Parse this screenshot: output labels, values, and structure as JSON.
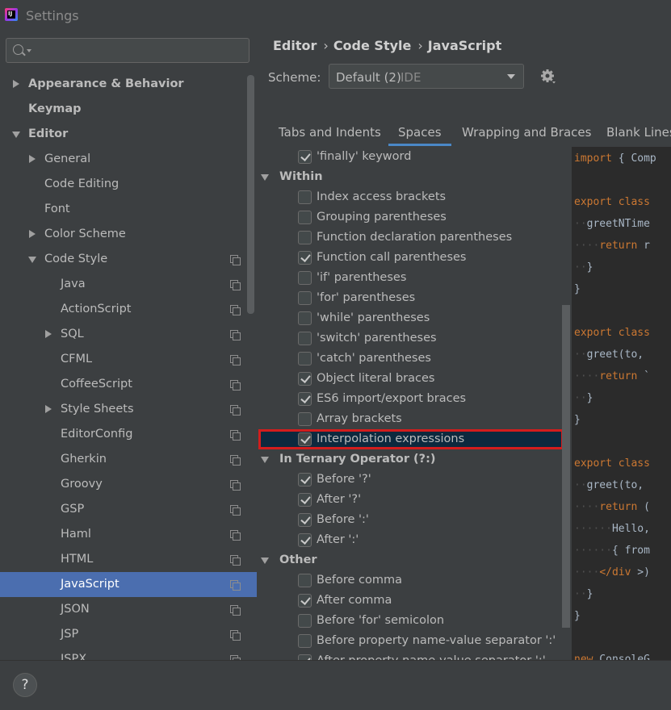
{
  "window": {
    "title": "Settings",
    "app_icon_text": "IJ"
  },
  "search": {
    "placeholder": ""
  },
  "sidebar": {
    "items": [
      {
        "label": "Appearance & Behavior",
        "level": 0,
        "bold": true,
        "expander": "collapsed",
        "copy_icon": false,
        "selected": false
      },
      {
        "label": "Keymap",
        "level": 0,
        "bold": true,
        "expander": "none",
        "copy_icon": false,
        "selected": false
      },
      {
        "label": "Editor",
        "level": 0,
        "bold": true,
        "expander": "expanded",
        "copy_icon": false,
        "selected": false
      },
      {
        "label": "General",
        "level": 1,
        "bold": false,
        "expander": "collapsed",
        "copy_icon": false,
        "selected": false
      },
      {
        "label": "Code Editing",
        "level": 1,
        "bold": false,
        "expander": "none",
        "copy_icon": false,
        "selected": false
      },
      {
        "label": "Font",
        "level": 1,
        "bold": false,
        "expander": "none",
        "copy_icon": false,
        "selected": false
      },
      {
        "label": "Color Scheme",
        "level": 1,
        "bold": false,
        "expander": "collapsed",
        "copy_icon": false,
        "selected": false
      },
      {
        "label": "Code Style",
        "level": 1,
        "bold": false,
        "expander": "expanded",
        "copy_icon": true,
        "selected": false
      },
      {
        "label": "Java",
        "level": 2,
        "bold": false,
        "expander": "none",
        "copy_icon": true,
        "selected": false
      },
      {
        "label": "ActionScript",
        "level": 2,
        "bold": false,
        "expander": "none",
        "copy_icon": true,
        "selected": false
      },
      {
        "label": "SQL",
        "level": 2,
        "bold": false,
        "expander": "collapsed",
        "copy_icon": true,
        "selected": false
      },
      {
        "label": "CFML",
        "level": 2,
        "bold": false,
        "expander": "none",
        "copy_icon": true,
        "selected": false
      },
      {
        "label": "CoffeeScript",
        "level": 2,
        "bold": false,
        "expander": "none",
        "copy_icon": true,
        "selected": false
      },
      {
        "label": "Style Sheets",
        "level": 2,
        "bold": false,
        "expander": "collapsed",
        "copy_icon": true,
        "selected": false
      },
      {
        "label": "EditorConfig",
        "level": 2,
        "bold": false,
        "expander": "none",
        "copy_icon": true,
        "selected": false
      },
      {
        "label": "Gherkin",
        "level": 2,
        "bold": false,
        "expander": "none",
        "copy_icon": true,
        "selected": false
      },
      {
        "label": "Groovy",
        "level": 2,
        "bold": false,
        "expander": "none",
        "copy_icon": true,
        "selected": false
      },
      {
        "label": "GSP",
        "level": 2,
        "bold": false,
        "expander": "none",
        "copy_icon": true,
        "selected": false
      },
      {
        "label": "Haml",
        "level": 2,
        "bold": false,
        "expander": "none",
        "copy_icon": true,
        "selected": false
      },
      {
        "label": "HTML",
        "level": 2,
        "bold": false,
        "expander": "none",
        "copy_icon": true,
        "selected": false
      },
      {
        "label": "JavaScript",
        "level": 2,
        "bold": false,
        "expander": "none",
        "copy_icon": true,
        "selected": true
      },
      {
        "label": "JSON",
        "level": 2,
        "bold": false,
        "expander": "none",
        "copy_icon": true,
        "selected": false
      },
      {
        "label": "JSP",
        "level": 2,
        "bold": false,
        "expander": "none",
        "copy_icon": true,
        "selected": false
      },
      {
        "label": "JSPX",
        "level": 2,
        "bold": false,
        "expander": "none",
        "copy_icon": true,
        "selected": false
      }
    ]
  },
  "breadcrumb": {
    "items": [
      "Editor",
      "Code Style",
      "JavaScript"
    ],
    "separator": "›"
  },
  "scheme": {
    "label": "Scheme:",
    "value": "Default (2)",
    "sub": "IDE"
  },
  "tabs": [
    {
      "label": "Tabs and Indents",
      "active": false
    },
    {
      "label": "Spaces",
      "active": true
    },
    {
      "label": "Wrapping and Braces",
      "active": false
    },
    {
      "label": "Blank Lines",
      "active": false
    }
  ],
  "options": [
    {
      "type": "checkbox",
      "label": "'finally' keyword",
      "checked": true
    },
    {
      "type": "group",
      "label": "Within"
    },
    {
      "type": "checkbox",
      "label": "Index access brackets",
      "checked": false
    },
    {
      "type": "checkbox",
      "label": "Grouping parentheses",
      "checked": false
    },
    {
      "type": "checkbox",
      "label": "Function declaration parentheses",
      "checked": false
    },
    {
      "type": "checkbox",
      "label": "Function call parentheses",
      "checked": true
    },
    {
      "type": "checkbox",
      "label": "'if' parentheses",
      "checked": false
    },
    {
      "type": "checkbox",
      "label": "'for' parentheses",
      "checked": false
    },
    {
      "type": "checkbox",
      "label": "'while' parentheses",
      "checked": false
    },
    {
      "type": "checkbox",
      "label": "'switch' parentheses",
      "checked": false
    },
    {
      "type": "checkbox",
      "label": "'catch' parentheses",
      "checked": false
    },
    {
      "type": "checkbox",
      "label": "Object literal braces",
      "checked": true
    },
    {
      "type": "checkbox",
      "label": "ES6 import/export braces",
      "checked": true
    },
    {
      "type": "checkbox",
      "label": "Array brackets",
      "checked": false
    },
    {
      "type": "checkbox",
      "label": "Interpolation expressions",
      "checked": true,
      "highlighted": true
    },
    {
      "type": "group",
      "label": "In Ternary Operator (?:)"
    },
    {
      "type": "checkbox",
      "label": "Before '?'",
      "checked": true
    },
    {
      "type": "checkbox",
      "label": "After '?'",
      "checked": true
    },
    {
      "type": "checkbox",
      "label": "Before ':'",
      "checked": true
    },
    {
      "type": "checkbox",
      "label": "After ':'",
      "checked": true
    },
    {
      "type": "group",
      "label": "Other"
    },
    {
      "type": "checkbox",
      "label": "Before comma",
      "checked": false
    },
    {
      "type": "checkbox",
      "label": "After comma",
      "checked": true
    },
    {
      "type": "checkbox",
      "label": "Before 'for' semicolon",
      "checked": false
    },
    {
      "type": "checkbox",
      "label": "Before property name-value separator ':'",
      "checked": false
    },
    {
      "type": "checkbox",
      "label": "After property name-value separator ':'",
      "checked": true
    }
  ],
  "preview": {
    "lines": [
      [
        {
          "t": "import",
          "c": "kw"
        },
        {
          "t": " { Comp",
          "c": "punc"
        }
      ],
      [],
      [
        {
          "t": "export class",
          "c": "kw"
        }
      ],
      [
        {
          "t": "··",
          "c": "ws"
        },
        {
          "t": "greetNTime",
          "c": "fn"
        }
      ],
      [
        {
          "t": "····",
          "c": "ws"
        },
        {
          "t": "return",
          "c": "kw"
        },
        {
          "t": " r",
          "c": "punc"
        }
      ],
      [
        {
          "t": "··",
          "c": "ws"
        },
        {
          "t": "}",
          "c": "punc"
        }
      ],
      [
        {
          "t": "}",
          "c": "punc"
        }
      ],
      [],
      [
        {
          "t": "export class",
          "c": "kw"
        }
      ],
      [
        {
          "t": "··",
          "c": "ws"
        },
        {
          "t": "greet(to,",
          "c": "fn"
        }
      ],
      [
        {
          "t": "····",
          "c": "ws"
        },
        {
          "t": "return",
          "c": "kw"
        },
        {
          "t": " `",
          "c": "punc"
        }
      ],
      [
        {
          "t": "··",
          "c": "ws"
        },
        {
          "t": "}",
          "c": "punc"
        }
      ],
      [
        {
          "t": "}",
          "c": "punc"
        }
      ],
      [],
      [
        {
          "t": "export class",
          "c": "kw"
        }
      ],
      [
        {
          "t": "··",
          "c": "ws"
        },
        {
          "t": "greet(to,",
          "c": "fn"
        }
      ],
      [
        {
          "t": "····",
          "c": "ws"
        },
        {
          "t": "return",
          "c": "kw"
        },
        {
          "t": " (",
          "c": "punc"
        }
      ],
      [
        {
          "t": "······",
          "c": "ws"
        },
        {
          "t": "Hello,",
          "c": "fn"
        }
      ],
      [
        {
          "t": "······",
          "c": "ws"
        },
        {
          "t": "{ from",
          "c": "fn"
        }
      ],
      [
        {
          "t": "····",
          "c": "ws"
        },
        {
          "t": "</div",
          "c": "kw"
        },
        {
          "t": " >)",
          "c": "punc"
        }
      ],
      [
        {
          "t": "··",
          "c": "ws"
        },
        {
          "t": "}",
          "c": "punc"
        }
      ],
      [
        {
          "t": "}",
          "c": "punc"
        }
      ],
      [],
      [
        {
          "t": "new",
          "c": "kw"
        },
        {
          "t": " ConsoleG",
          "c": "punc"
        }
      ]
    ]
  },
  "footer": {
    "help_label": "?"
  }
}
